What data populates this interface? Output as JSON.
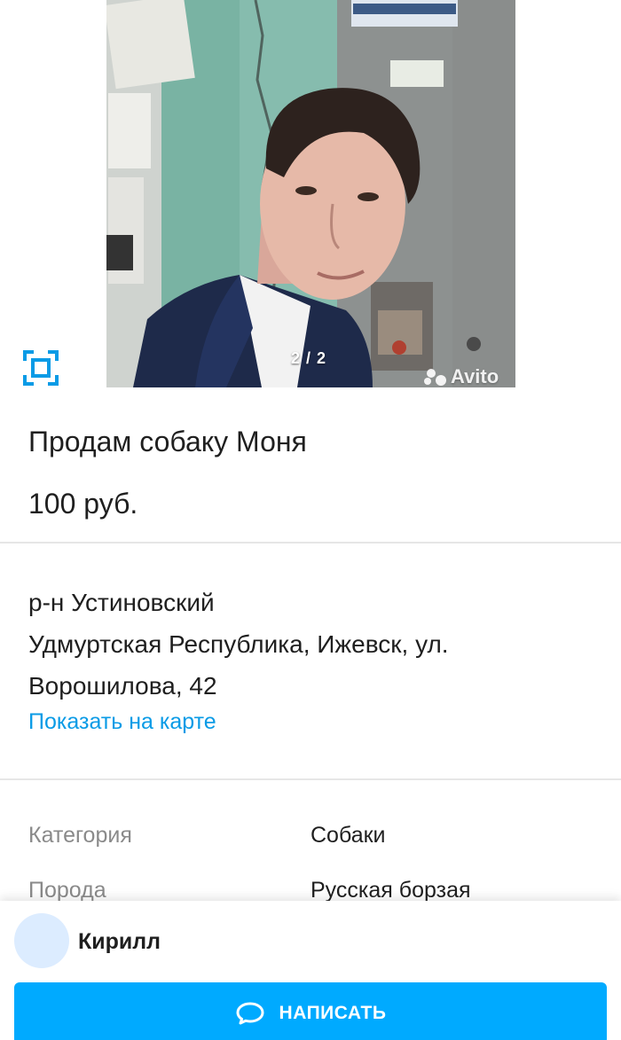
{
  "colors": {
    "accent": "#00aaff",
    "link": "#0a9be6",
    "text": "#1f1f1f",
    "muted": "#8a8a8a",
    "divider": "#e6e6e6",
    "avatar_bg": "#dcecff"
  },
  "gallery": {
    "counter": "2 / 2",
    "watermark": "Avito",
    "fullscreen_icon": "fullscreen-icon"
  },
  "listing": {
    "title": "Продам собаку Моня",
    "price": "100 руб."
  },
  "location": {
    "district": "р-н Устиновский",
    "address_line1": "Удмуртская Республика, Ижевск, ул.",
    "address_line2": "Ворошилова, 42",
    "map_link": "Показать на карте"
  },
  "params": [
    {
      "name": "Категория",
      "value": "Собаки"
    },
    {
      "name": "Порода",
      "value": "Русская борзая"
    }
  ],
  "seller": {
    "name": "Кирилл"
  },
  "actions": {
    "write_label": "НАПИСАТЬ",
    "write_icon": "chat-bubble-icon"
  }
}
